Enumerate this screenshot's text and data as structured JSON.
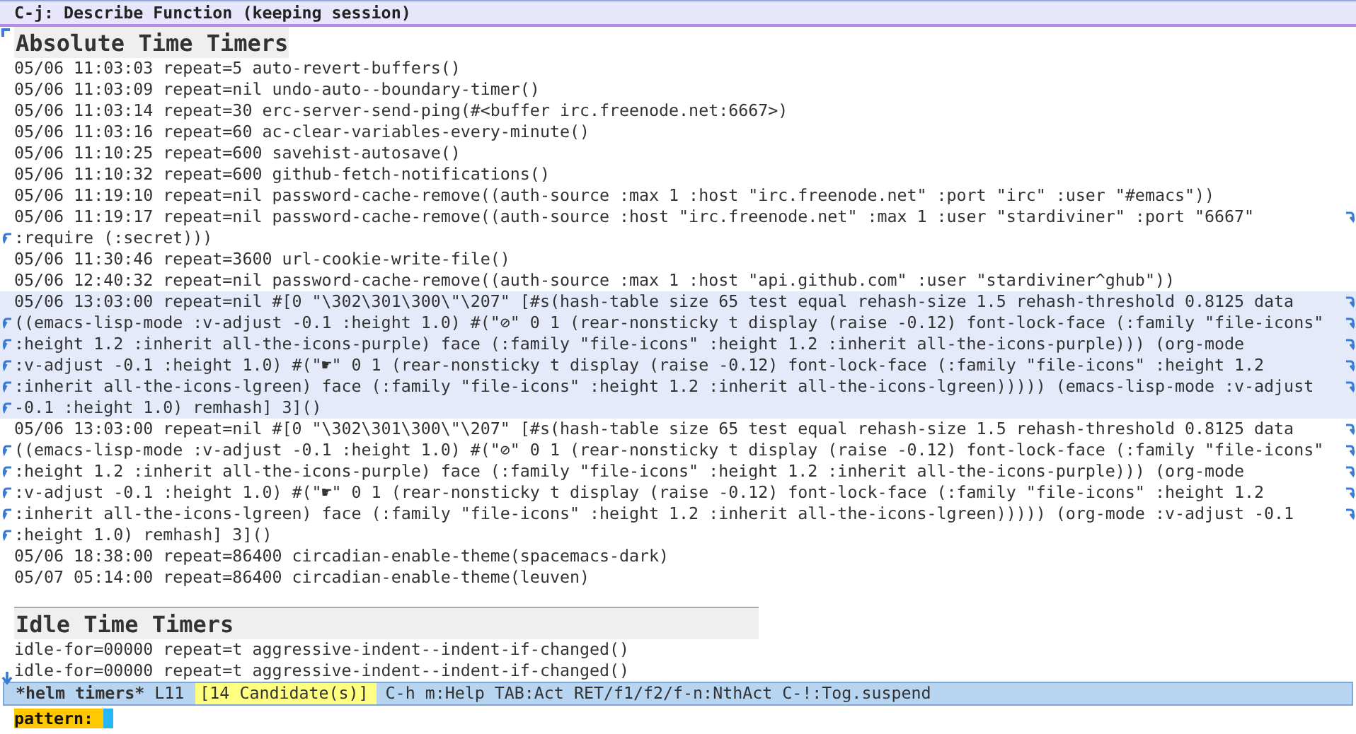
{
  "header_line": {
    "title": "C-j: Describe Function (keeping session)"
  },
  "sections": [
    {
      "title": "Absolute Time Timers",
      "entries": [
        {
          "selected": false,
          "lines": [
            "05/06 11:03:03 repeat=5 auto-revert-buffers()"
          ]
        },
        {
          "selected": false,
          "lines": [
            "05/06 11:03:09 repeat=nil undo-auto--boundary-timer()"
          ]
        },
        {
          "selected": false,
          "lines": [
            "05/06 11:03:14 repeat=30 erc-server-send-ping(#<buffer irc.freenode.net:6667>)"
          ]
        },
        {
          "selected": false,
          "lines": [
            "05/06 11:03:16 repeat=60 ac-clear-variables-every-minute()"
          ]
        },
        {
          "selected": false,
          "lines": [
            "05/06 11:10:25 repeat=600 savehist-autosave()"
          ]
        },
        {
          "selected": false,
          "lines": [
            "05/06 11:10:32 repeat=600 github-fetch-notifications()"
          ]
        },
        {
          "selected": false,
          "lines": [
            "05/06 11:19:10 repeat=nil password-cache-remove((auth-source :max 1 :host \"irc.freenode.net\" :port \"irc\" :user \"#emacs\"))"
          ]
        },
        {
          "selected": false,
          "lines": [
            "05/06 11:19:17 repeat=nil password-cache-remove((auth-source :host \"irc.freenode.net\" :max 1 :user \"stardiviner\" :port \"6667\"",
            ":require (:secret)))"
          ]
        },
        {
          "selected": false,
          "lines": [
            "05/06 11:30:46 repeat=3600 url-cookie-write-file()"
          ]
        },
        {
          "selected": false,
          "lines": [
            "05/06 12:40:32 repeat=nil password-cache-remove((auth-source :max 1 :host \"api.github.com\" :user \"stardiviner^ghub\"))"
          ]
        },
        {
          "selected": true,
          "lines": [
            "05/06 13:03:00 repeat=nil #[0 \"\\302\\301\\300\\\"\\207\" [#s(hash-table size 65 test equal rehash-size 1.5 rehash-threshold 0.8125 data",
            "((emacs-lisp-mode :v-adjust -0.1 :height 1.0) #(\"⊘\" 0 1 (rear-nonsticky t display (raise -0.12) font-lock-face (:family \"file-icons\"",
            ":height 1.2 :inherit all-the-icons-purple) face (:family \"file-icons\" :height 1.2 :inherit all-the-icons-purple))) (org-mode",
            ":v-adjust -0.1 :height 1.0) #(\"☛\" 0 1 (rear-nonsticky t display (raise -0.12) font-lock-face (:family \"file-icons\" :height 1.2",
            ":inherit all-the-icons-lgreen) face (:family \"file-icons\" :height 1.2 :inherit all-the-icons-lgreen))))) (emacs-lisp-mode :v-adjust",
            "-0.1 :height 1.0) remhash] 3]()"
          ]
        },
        {
          "selected": false,
          "lines": [
            "05/06 13:03:00 repeat=nil #[0 \"\\302\\301\\300\\\"\\207\" [#s(hash-table size 65 test equal rehash-size 1.5 rehash-threshold 0.8125 data",
            "((emacs-lisp-mode :v-adjust -0.1 :height 1.0) #(\"⊘\" 0 1 (rear-nonsticky t display (raise -0.12) font-lock-face (:family \"file-icons\"",
            ":height 1.2 :inherit all-the-icons-purple) face (:family \"file-icons\" :height 1.2 :inherit all-the-icons-purple))) (org-mode",
            ":v-adjust -0.1 :height 1.0) #(\"☛\" 0 1 (rear-nonsticky t display (raise -0.12) font-lock-face (:family \"file-icons\" :height 1.2",
            ":inherit all-the-icons-lgreen) face (:family \"file-icons\" :height 1.2 :inherit all-the-icons-lgreen))))) (org-mode :v-adjust -0.1",
            ":height 1.0) remhash] 3]()"
          ]
        },
        {
          "selected": false,
          "lines": [
            "05/06 18:38:00 repeat=86400 circadian-enable-theme(spacemacs-dark)"
          ]
        },
        {
          "selected": false,
          "lines": [
            "05/07 05:14:00 repeat=86400 circadian-enable-theme(leuven)"
          ]
        }
      ]
    },
    {
      "title": "Idle Time Timers",
      "entries": [
        {
          "selected": false,
          "lines": [
            "idle-for=00000 repeat=t aggressive-indent--indent-if-changed()"
          ]
        },
        {
          "selected": false,
          "lines": [
            "idle-for=00000 repeat=t aggressive-indent--indent-if-changed()"
          ]
        }
      ]
    }
  ],
  "mode_line": {
    "buffer": "*helm timers*",
    "line": "L11",
    "candidates": "[14 Candidate(s)]",
    "keys": "C-h m:Help TAB:Act RET/f1/f2/f-n:NthAct C-!:Tog.suspend"
  },
  "minibuffer": {
    "prompt": "pattern:"
  }
}
